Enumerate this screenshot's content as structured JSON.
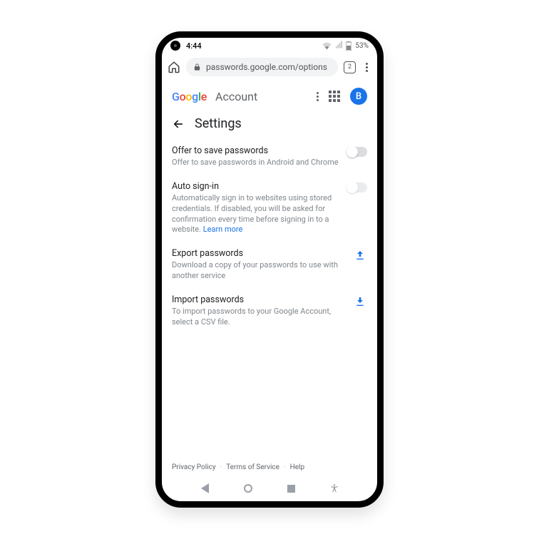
{
  "status": {
    "time": "4:44",
    "battery": "53%"
  },
  "browser": {
    "url": "passwords.google.com/options",
    "tab_count": "2"
  },
  "header": {
    "logo_word": "Google",
    "account_label": "Account",
    "avatar_letter": "B"
  },
  "page": {
    "title": "Settings"
  },
  "settings": {
    "offer_save": {
      "title": "Offer to save passwords",
      "desc": "Offer to save passwords in Android and Chrome"
    },
    "auto_signin": {
      "title": "Auto sign-in",
      "desc": "Automatically sign in to websites using stored credentials. If disabled, you will be asked for confirmation every time before signing in to a website. ",
      "learn_more": "Learn more"
    },
    "export": {
      "title": "Export passwords",
      "desc": "Download a copy of your passwords to use with another service"
    },
    "import": {
      "title": "Import passwords",
      "desc": "To import passwords to your Google Account, select a CSV file."
    }
  },
  "footer": {
    "privacy": "Privacy Policy",
    "terms": "Terms of Service",
    "help": "Help"
  }
}
